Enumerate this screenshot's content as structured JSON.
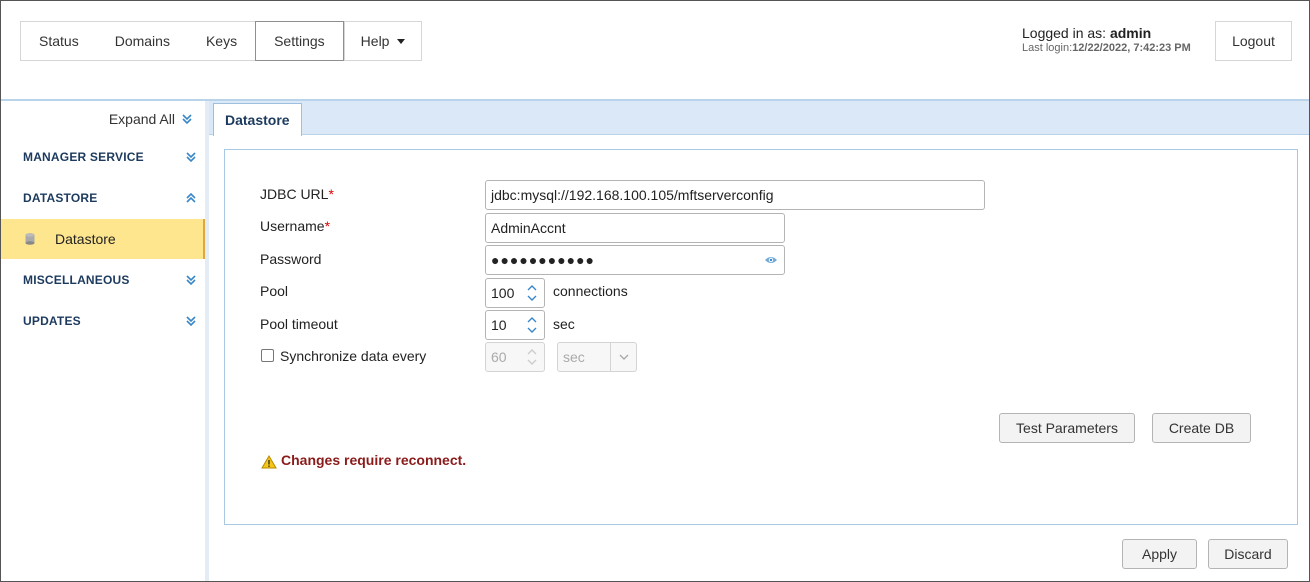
{
  "nav": {
    "items": [
      {
        "label": "Status"
      },
      {
        "label": "Domains"
      },
      {
        "label": "Keys"
      },
      {
        "label": "Settings"
      },
      {
        "label": "Help"
      }
    ]
  },
  "login": {
    "prefix": "Logged in as: ",
    "user": "admin",
    "last_prefix": "Last login:",
    "last_value": "12/22/2022, 7:42:23 PM",
    "logout_label": "Logout"
  },
  "sidebar": {
    "expand_all": "Expand All",
    "sections": [
      {
        "label": "MANAGER SERVICE",
        "state": "collapsed"
      },
      {
        "label": "DATASTORE",
        "state": "expanded"
      },
      {
        "label": "MISCELLANEOUS",
        "state": "collapsed"
      },
      {
        "label": "UPDATES",
        "state": "collapsed"
      }
    ],
    "active_item": "Datastore"
  },
  "tab": {
    "label": "Datastore"
  },
  "form": {
    "jdbc_label": "JDBC URL",
    "jdbc_value": "jdbc:mysql://192.168.100.105/mftserverconfig",
    "username_label": "Username",
    "username_value": "AdminAccnt",
    "password_label": "Password",
    "password_value": "●●●●●●●●●●●",
    "pool_label": "Pool",
    "pool_value": "100",
    "pool_unit": "connections",
    "timeout_label": "Pool timeout",
    "timeout_value": "10",
    "timeout_unit": "sec",
    "sync_label": "Synchronize data every",
    "sync_value": "60",
    "sync_unit": "sec",
    "required_mark": "*"
  },
  "buttons": {
    "test": "Test Parameters",
    "create": "Create DB",
    "apply": "Apply",
    "discard": "Discard"
  },
  "warning": "Changes require reconnect.",
  "colors": {
    "accent": "#1c3a5e",
    "active_bg": "#fde68e",
    "required": "#dd0000",
    "warning": "#8b1a1a"
  }
}
